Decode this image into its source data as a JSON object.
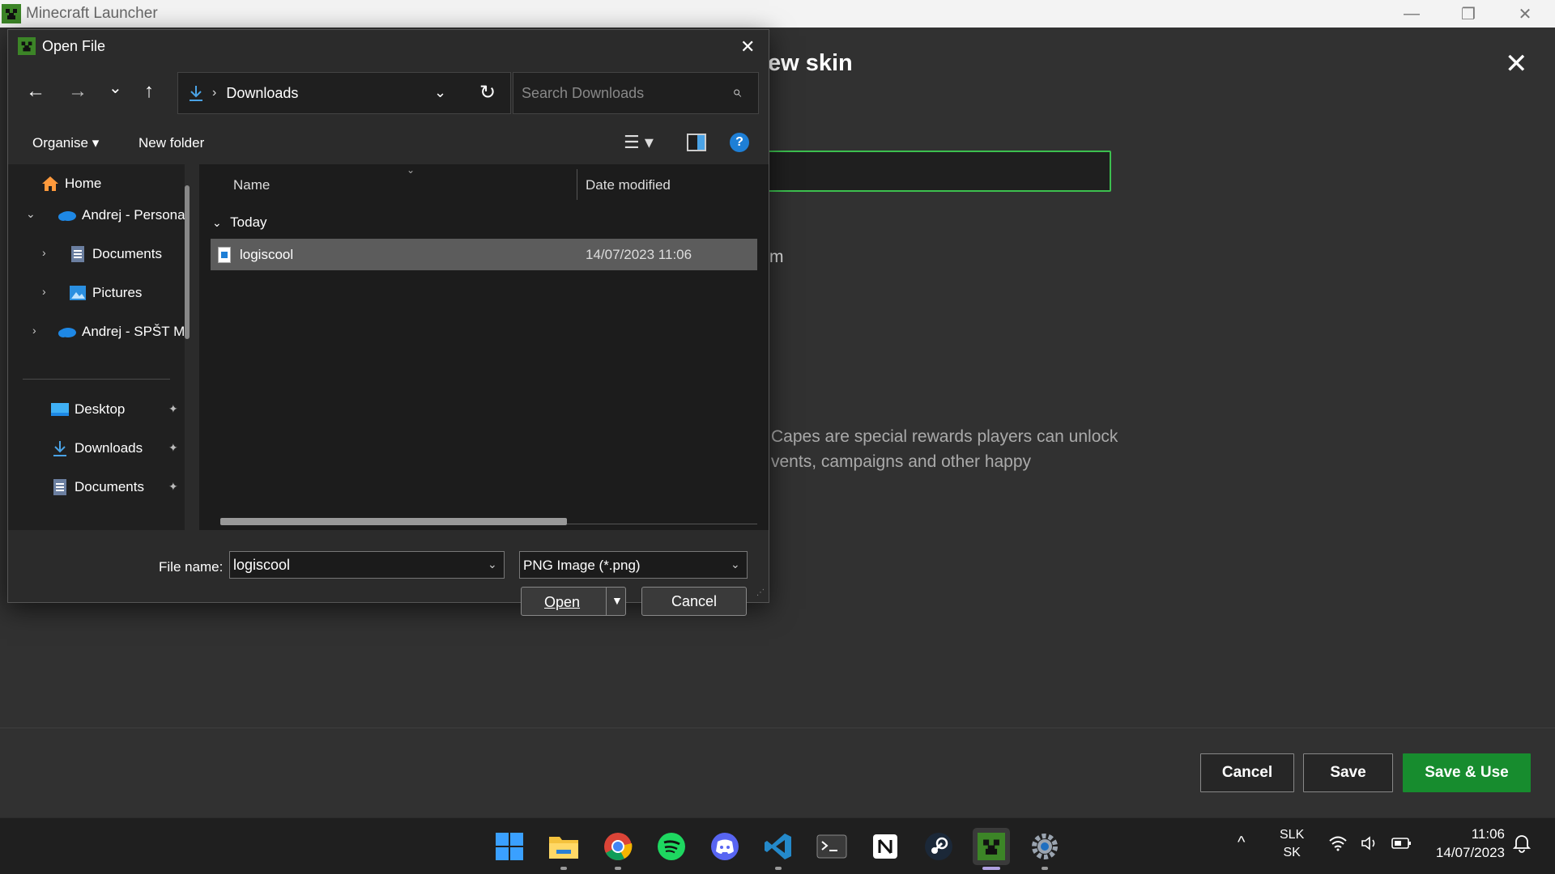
{
  "launcher": {
    "window_title": "Minecraft Launcher",
    "controls": {
      "minimize": "—",
      "maximize": "❐",
      "close": "✕"
    },
    "panel_title": "ew skin",
    "panel_close": "✕",
    "fragment_m": "m",
    "capes_text": "Capes are special rewards players can unlock vents, campaigns and other happy",
    "buttons": {
      "cancel": "Cancel",
      "save": "Save",
      "save_use": "Save & Use"
    },
    "colors": {
      "accent": "#3cc04f",
      "primary_button": "#178c2e"
    }
  },
  "dialog": {
    "title": "Open File",
    "close": "✕",
    "nav": {
      "back": "←",
      "forward": "→",
      "recent": "⌄",
      "up": "↑"
    },
    "address": {
      "icon": "download-icon",
      "separator": "›",
      "location": "Downloads",
      "dropdown": "⌄",
      "refresh": "↻"
    },
    "search": {
      "placeholder": "Search Downloads",
      "icon": "⌕"
    },
    "commands": {
      "organise": "Organise ▾",
      "new_folder": "New folder",
      "view": "☰ ▾",
      "help": "?"
    },
    "nav_pane": {
      "items": [
        {
          "label": "Home",
          "icon": "home-icon",
          "glyph": "⌂",
          "chevron": ""
        },
        {
          "label": "Andrej - Persona",
          "icon": "onedrive-icon",
          "glyph": "☁",
          "chevron": "⌄"
        },
        {
          "label": "Documents",
          "icon": "documents-icon",
          "glyph": "▤",
          "chevron": "›"
        },
        {
          "label": "Pictures",
          "icon": "pictures-icon",
          "glyph": "▲",
          "chevron": "›"
        },
        {
          "label": "Andrej - SPŠT M",
          "icon": "onedrive-icon",
          "glyph": "☁",
          "chevron": "›"
        }
      ],
      "quick_access": [
        {
          "label": "Desktop",
          "icon": "desktop-icon",
          "glyph": "▬",
          "pin": "✦"
        },
        {
          "label": "Downloads",
          "icon": "download-icon",
          "glyph": "↓",
          "pin": "✦"
        },
        {
          "label": "Documents",
          "icon": "documents-icon",
          "glyph": "▤",
          "pin": "✦"
        }
      ]
    },
    "columns": {
      "name": "Name",
      "sort": "⌄",
      "date_modified": "Date modified"
    },
    "group": {
      "chevron": "⌄",
      "label": "Today"
    },
    "files": [
      {
        "name": "logiscool",
        "date": "14/07/2023 11:06"
      }
    ],
    "bottom": {
      "file_name_label": "File name:",
      "file_name_value": "logiscool",
      "dropdown": "⌄",
      "file_type": "PNG Image (*.png)",
      "open": "Open",
      "open_arrow": "▼",
      "cancel": "Cancel",
      "grip": "⋰"
    }
  },
  "taskbar": {
    "apps": [
      {
        "name": "start-button",
        "icon": "windows-icon"
      },
      {
        "name": "file-explorer",
        "icon": "folder-icon"
      },
      {
        "name": "chrome",
        "icon": "chrome-icon"
      },
      {
        "name": "spotify",
        "icon": "spotify-icon"
      },
      {
        "name": "discord",
        "icon": "discord-icon"
      },
      {
        "name": "vscode",
        "icon": "vscode-icon"
      },
      {
        "name": "terminal",
        "icon": "terminal-icon"
      },
      {
        "name": "notion",
        "icon": "notion-icon"
      },
      {
        "name": "steam",
        "icon": "steam-icon"
      },
      {
        "name": "minecraft-launcher",
        "icon": "minecraft-icon"
      },
      {
        "name": "settings",
        "icon": "gear-icon"
      }
    ],
    "tray_chevron": "^",
    "language": {
      "line1": "SLK",
      "line2": "SK"
    },
    "tray_icons": {
      "wifi": "wifi-icon",
      "volume": "volume-icon",
      "battery": "battery-icon"
    },
    "clock": {
      "time": "11:06",
      "date": "14/07/2023"
    },
    "notifications": "notification-icon"
  }
}
